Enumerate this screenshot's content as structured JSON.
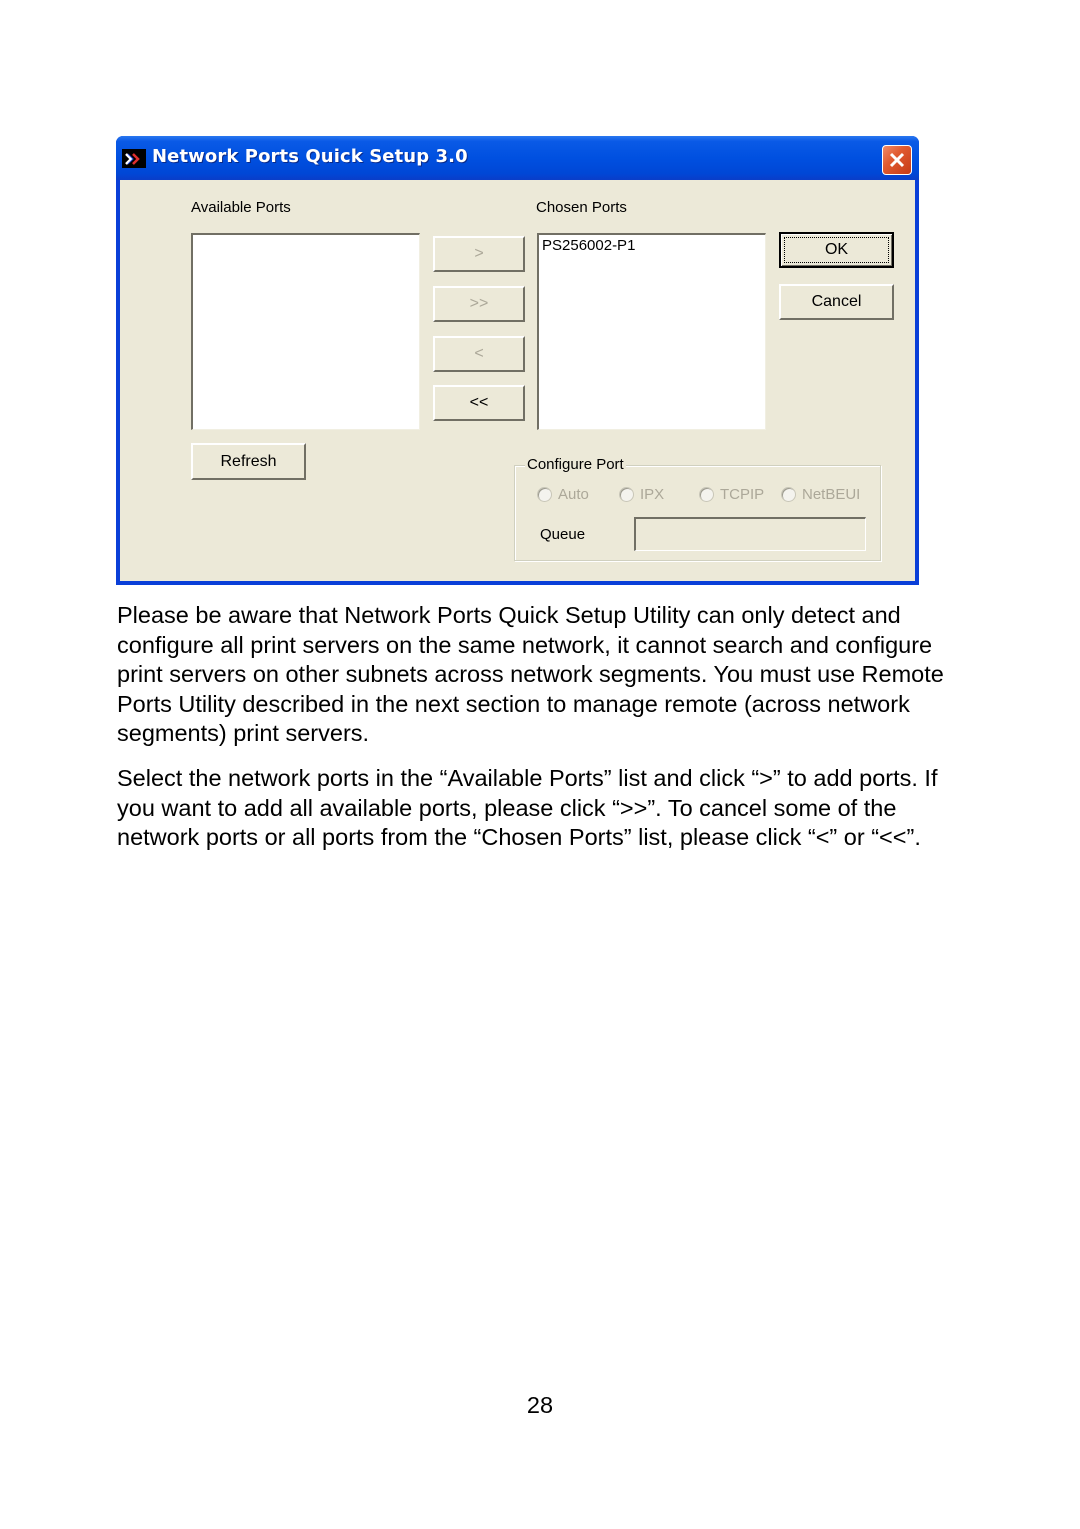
{
  "dialog": {
    "title": "Network Ports Quick Setup 3.0",
    "icon": "double-chevron-icon",
    "close_icon": "close-icon",
    "available_ports": {
      "label": "Available Ports",
      "items": []
    },
    "chosen_ports": {
      "label": "Chosen Ports",
      "items": [
        "PS256002-P1"
      ]
    },
    "transfer_buttons": {
      "add": ">",
      "add_all": ">>",
      "remove": "<",
      "remove_all": "<<"
    },
    "ok_label": "OK",
    "cancel_label": "Cancel",
    "refresh_label": "Refresh",
    "configure_port": {
      "label": "Configure Port",
      "options": [
        "Auto",
        "IPX",
        "TCPIP",
        "NetBEUI"
      ],
      "queue_label": "Queue",
      "queue_value": ""
    }
  },
  "document": {
    "paragraphs": [
      "Please be aware that Network Ports Quick Setup Utility can only detect and configure all print servers on the same network, it cannot search and configure print servers on other subnets across network segments. You must use Remote Ports Utility described in the next section to manage remote (across network segments) print servers.",
      "Select the network ports in the “Available Ports” list and click “>” to add ports. If you want to add all available ports, please click “>>”. To cancel some of the network ports or all ports from the “Chosen Ports” list, please click “<” or “<<”."
    ],
    "page_number": "28"
  }
}
